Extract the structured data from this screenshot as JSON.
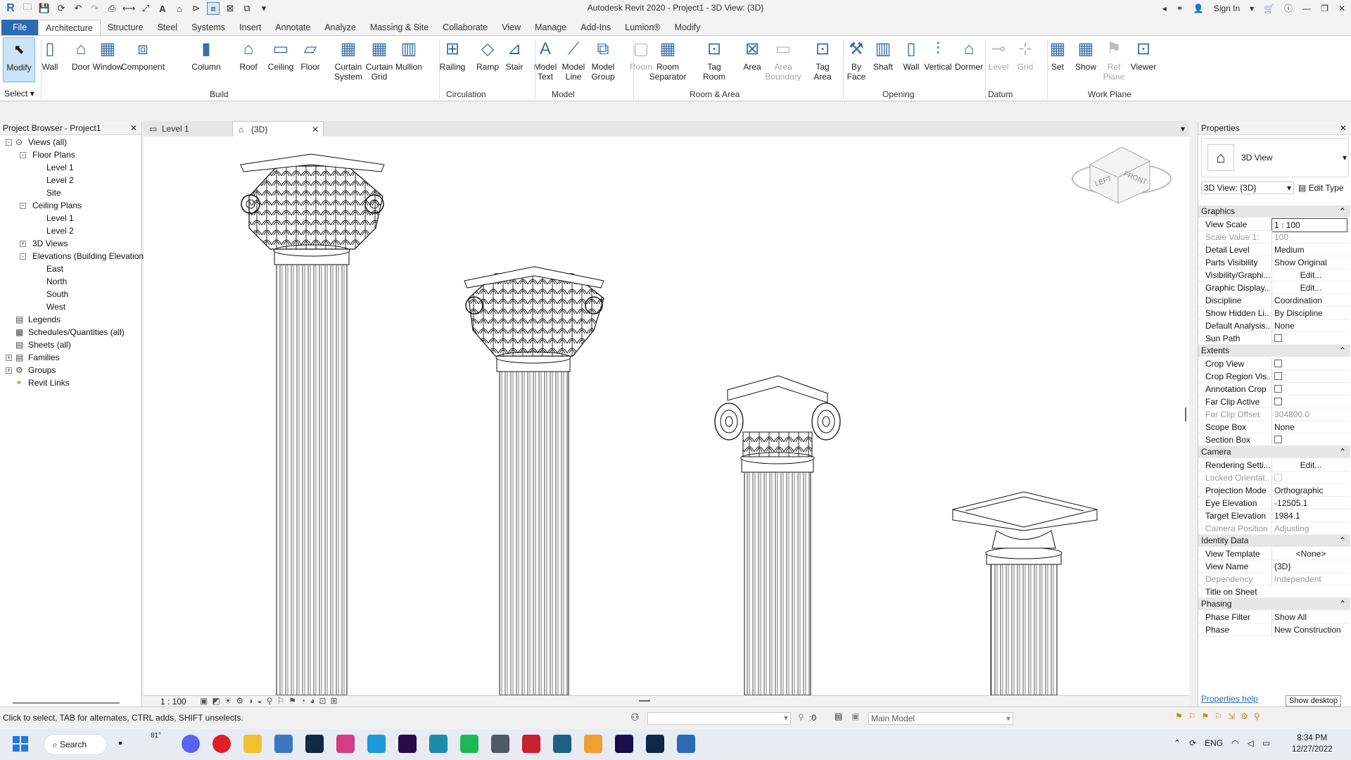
{
  "app": {
    "title": "Autodesk Revit 2020 - Project1 - 3D View: {3D}",
    "sign_in": "Sign In"
  },
  "tabs": [
    "File",
    "Architecture",
    "Structure",
    "Steel",
    "Systems",
    "Insert",
    "Annotate",
    "Analyze",
    "Massing & Site",
    "Collaborate",
    "View",
    "Manage",
    "Add-Ins",
    "Lumion®",
    "Modify"
  ],
  "ribbon": {
    "modify": "Modify",
    "select": "Select",
    "build": {
      "label": "Build",
      "items": [
        [
          "Wall",
          ""
        ],
        [
          "Door",
          ""
        ],
        [
          "Window",
          ""
        ],
        [
          "Component",
          ""
        ],
        [
          "Column",
          ""
        ],
        [
          "Roof",
          ""
        ],
        [
          "Ceiling",
          ""
        ],
        [
          "Floor",
          ""
        ],
        [
          "Curtain",
          "System"
        ],
        [
          "Curtain",
          "Grid"
        ],
        [
          "Mullion",
          ""
        ]
      ]
    },
    "circulation": {
      "label": "Circulation",
      "items": [
        [
          "Railing",
          ""
        ],
        [
          "Ramp",
          ""
        ],
        [
          "Stair",
          ""
        ]
      ]
    },
    "model": {
      "label": "Model",
      "items": [
        [
          "Model",
          "Text"
        ],
        [
          "Model",
          "Line"
        ],
        [
          "Model",
          "Group"
        ]
      ]
    },
    "room_area": {
      "label": "Room & Area",
      "items": [
        [
          "Room",
          ""
        ],
        [
          "Room",
          "Separator"
        ],
        [
          "Tag",
          "Room"
        ],
        [
          "Area",
          ""
        ],
        [
          "Area",
          "Boundary"
        ],
        [
          "Tag",
          "Area"
        ]
      ]
    },
    "opening": {
      "label": "Opening",
      "items": [
        [
          "By",
          "Face"
        ],
        [
          "Shaft",
          ""
        ],
        [
          "Wall",
          ""
        ],
        [
          "Vertical",
          ""
        ],
        [
          "Dormer",
          ""
        ]
      ]
    },
    "datum": {
      "label": "Datum",
      "items": [
        [
          "Level",
          ""
        ],
        [
          "Grid",
          ""
        ]
      ]
    },
    "workplane": {
      "label": "Work Plane",
      "items": [
        [
          "Set",
          ""
        ],
        [
          "Show",
          ""
        ],
        [
          "Ref",
          "Plane"
        ],
        [
          "Viewer",
          ""
        ]
      ]
    }
  },
  "browser": {
    "title": "Project Browser - Project1",
    "items": [
      {
        "label": "Views (all)",
        "level": 0,
        "tog": "-"
      },
      {
        "label": "Floor Plans",
        "level": 1,
        "tog": "-"
      },
      {
        "label": "Level 1",
        "level": 2
      },
      {
        "label": "Level 2",
        "level": 2
      },
      {
        "label": "Site",
        "level": 2
      },
      {
        "label": "Ceiling Plans",
        "level": 1,
        "tog": "-"
      },
      {
        "label": "Level 1",
        "level": 2
      },
      {
        "label": "Level 2",
        "level": 2
      },
      {
        "label": "3D Views",
        "level": 1,
        "tog": "+"
      },
      {
        "label": "Elevations (Building Elevation)",
        "level": 1,
        "tog": "-"
      },
      {
        "label": "East",
        "level": 2
      },
      {
        "label": "North",
        "level": 2
      },
      {
        "label": "South",
        "level": 2
      },
      {
        "label": "West",
        "level": 2
      },
      {
        "label": "Legends",
        "level": 0
      },
      {
        "label": "Schedules/Quantities (all)",
        "level": 0
      },
      {
        "label": "Sheets (all)",
        "level": 0
      },
      {
        "label": "Families",
        "level": 0,
        "tog": "+"
      },
      {
        "label": "Groups",
        "level": 0,
        "tog": "+"
      },
      {
        "label": "Revit Links",
        "level": 0
      }
    ]
  },
  "view_tabs": {
    "tab1": "Level 1",
    "tab2": "{3D}"
  },
  "viewcube": {
    "left": "LEFT",
    "front": "FRONT"
  },
  "view_bar": {
    "scale": "1 : 100"
  },
  "properties": {
    "title": "Properties",
    "type_name": "3D View",
    "selector": "3D View: {3D}",
    "edit_type": "Edit Type",
    "groups": [
      {
        "name": "Graphics",
        "rows": [
          [
            "View Scale",
            "1 : 100",
            ""
          ],
          [
            "Scale Value    1:",
            "100",
            "dis"
          ],
          [
            "Detail Level",
            "Medium",
            ""
          ],
          [
            "Parts Visibility",
            "Show Original",
            ""
          ],
          [
            "Visibility/Graphi...",
            "Edit...",
            "btn"
          ],
          [
            "Graphic Display...",
            "Edit...",
            "btn"
          ],
          [
            "Discipline",
            "Coordination",
            ""
          ],
          [
            "Show Hidden Li...",
            "By Discipline",
            ""
          ],
          [
            "Default Analysis...",
            "None",
            ""
          ],
          [
            "Sun Path",
            "",
            "chk"
          ]
        ]
      },
      {
        "name": "Extents",
        "rows": [
          [
            "Crop View",
            "",
            "chk"
          ],
          [
            "Crop Region Vis...",
            "",
            "chk"
          ],
          [
            "Annotation Crop",
            "",
            "chk"
          ],
          [
            "Far Clip Active",
            "",
            "chk"
          ],
          [
            "Far Clip Offset",
            "304800.0",
            "dis"
          ],
          [
            "Scope Box",
            "None",
            ""
          ],
          [
            "Section Box",
            "",
            "chk"
          ]
        ]
      },
      {
        "name": "Camera",
        "rows": [
          [
            "Rendering Setti...",
            "Edit...",
            "btn"
          ],
          [
            "Locked Orientat...",
            "",
            "dis"
          ],
          [
            "Projection Mode",
            "Orthographic",
            ""
          ],
          [
            "Eye Elevation",
            "-12505.1",
            ""
          ],
          [
            "Target Elevation",
            "1984.1",
            ""
          ],
          [
            "Camera Position",
            "Adjusting",
            "dis"
          ]
        ]
      },
      {
        "name": "Identity Data",
        "rows": [
          [
            "View Template",
            "<None>",
            "btn"
          ],
          [
            "View Name",
            "{3D}",
            ""
          ],
          [
            "Dependency",
            "Independent",
            "dis"
          ],
          [
            "Title on Sheet",
            "",
            ""
          ]
        ]
      },
      {
        "name": "Phasing",
        "rows": [
          [
            "Phase Filter",
            "Show All",
            ""
          ],
          [
            "Phase",
            "New Construction",
            ""
          ]
        ]
      }
    ],
    "help": "Properties help",
    "tooltip": "Show desktop"
  },
  "status": {
    "text": "Click to select, TAB for alternates, CTRL adds, SHIFT unselects.",
    "zero": ":0",
    "model": "Main Model"
  },
  "taskbar": {
    "search": "Search",
    "temp": "81°",
    "lang": "ENG",
    "time": "8:34 PM",
    "date": "12/27/2022"
  }
}
